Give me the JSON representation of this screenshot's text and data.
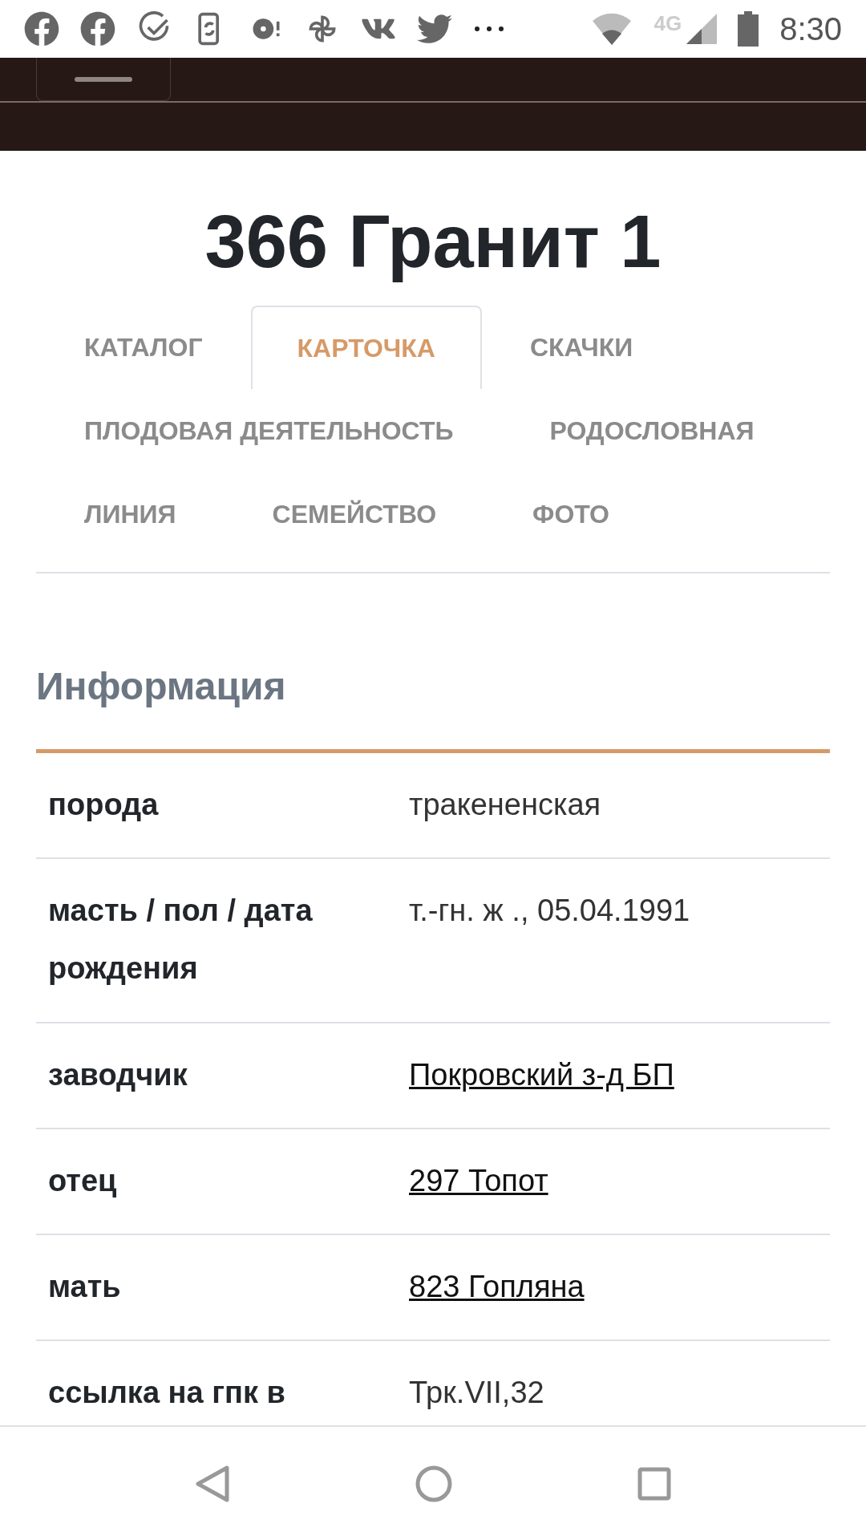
{
  "status_bar": {
    "time": "8:30",
    "network": "4G"
  },
  "title": "366 Гранит 1",
  "tabs": [
    {
      "label": "КАТАЛОГ",
      "selected": false
    },
    {
      "label": "КАРТОЧКА",
      "selected": true
    },
    {
      "label": "СКАЧКИ",
      "selected": false
    },
    {
      "label": "ПЛОДОВАЯ ДЕЯТЕЛЬНОСТЬ",
      "selected": false
    },
    {
      "label": "РОДОСЛОВНАЯ",
      "selected": false
    },
    {
      "label": "ЛИНИЯ",
      "selected": false
    },
    {
      "label": "СЕМЕЙСТВО",
      "selected": false
    },
    {
      "label": "ФОТО",
      "selected": false
    }
  ],
  "section_title": "Информация",
  "rows": [
    {
      "label": "порода",
      "value": "тракененская",
      "kind": "text"
    },
    {
      "label": "масть / пол / дата рождения",
      "value": "т.-гн. ж ., 05.04.1991",
      "kind": "text"
    },
    {
      "label": "заводчик",
      "value": "Покровский з-д БП",
      "kind": "link"
    },
    {
      "label": "отец",
      "value": "297 Топот",
      "kind": "link"
    },
    {
      "label": "мать",
      "value": "823 Гопляна",
      "kind": "link"
    },
    {
      "label": "ссылка на гпк в",
      "value": "Трк.VII,32",
      "kind": "text"
    }
  ]
}
